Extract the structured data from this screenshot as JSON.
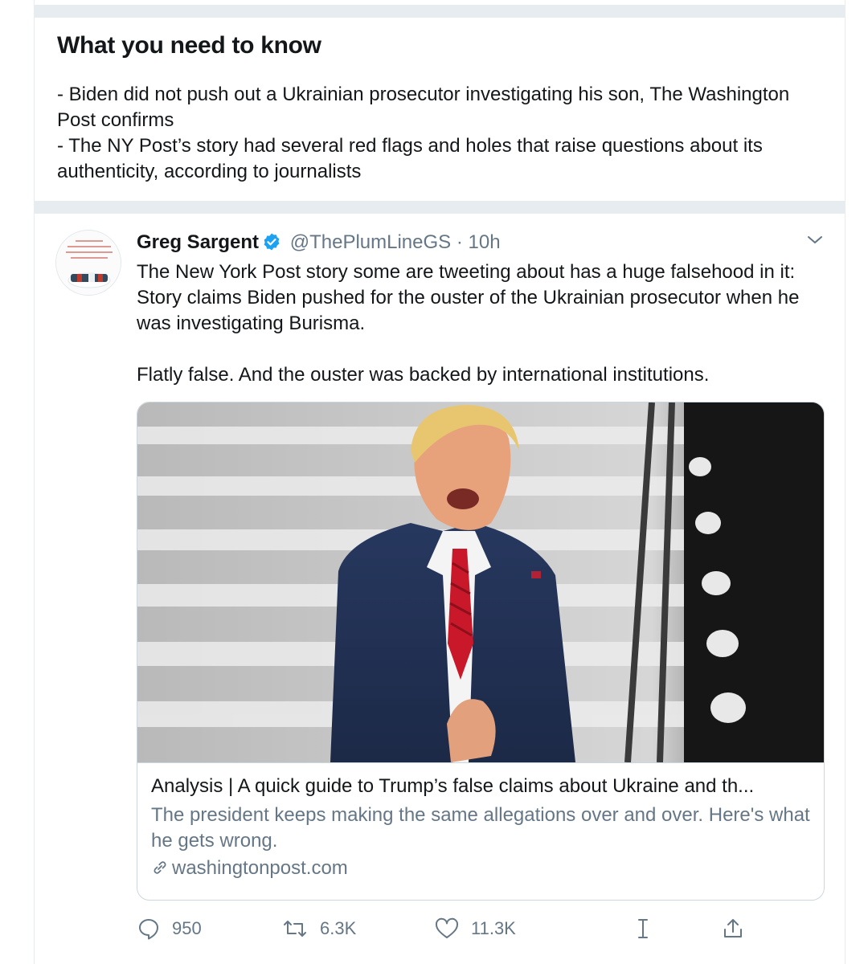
{
  "context": {
    "heading": "What you need to know",
    "bullet_1": "- Biden did not push out a Ukrainian prosecutor investigating his son, The Washington Post confirms",
    "bullet_2": "- The NY Post’s story had several red flags and holes that raise questions about its authenticity, according to journalists"
  },
  "tweet": {
    "author_name": "Greg Sargent",
    "handle": "@ThePlumLineGS",
    "separator": "·",
    "time": "10h",
    "text": "The New York Post story some are tweeting about has a huge falsehood in it: Story claims Biden pushed for the ouster of the Ukrainian prosecutor when he was investigating Burisma.\n\nFlatly false. And the ouster was backed by international institutions.",
    "avatar_text": "TAKING BACK OUR DEMOCRACY IN AN AGE OF TRUMPIAN DISINFORMATION AND THUNDERDOME POLITICS"
  },
  "card": {
    "title": "Analysis | A quick guide to Trump’s false claims about Ukraine and th...",
    "description": "The president keeps making the same allegations over and over. Here's what he gets wrong.",
    "domain": "washingtonpost.com"
  },
  "actions": {
    "replies": "950",
    "retweets": "6.3K",
    "likes": "11.3K"
  },
  "colors": {
    "text": "#14171a",
    "secondary": "#657786",
    "border": "#e6ecf0",
    "verified": "#1da1f2"
  }
}
